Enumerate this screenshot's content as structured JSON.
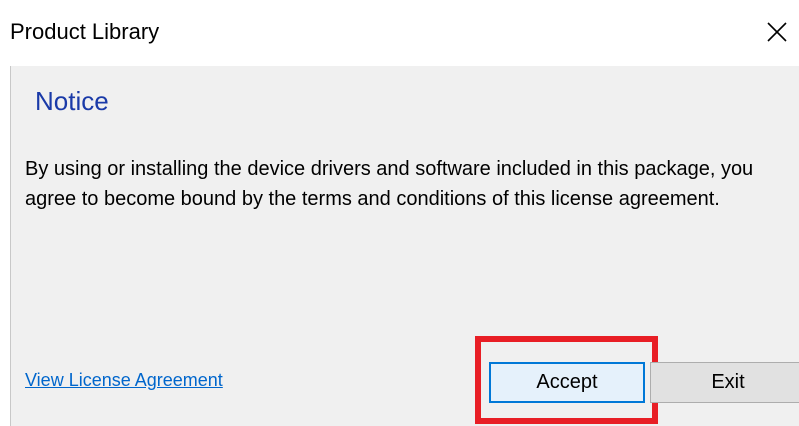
{
  "window": {
    "title": "Product Library"
  },
  "notice": {
    "heading": "Notice",
    "body": "By using or installing the device drivers and software included in this package, you agree to become bound by the terms and conditions of this license agreement."
  },
  "footer": {
    "license_link": "View License Agreement",
    "accept_label": "Accept",
    "exit_label": "Exit"
  },
  "colors": {
    "heading": "#1a3aa8",
    "link": "#0066cc",
    "highlight": "#e81e25",
    "focus_border": "#0078d7"
  },
  "icons": {
    "close": "close-icon"
  }
}
